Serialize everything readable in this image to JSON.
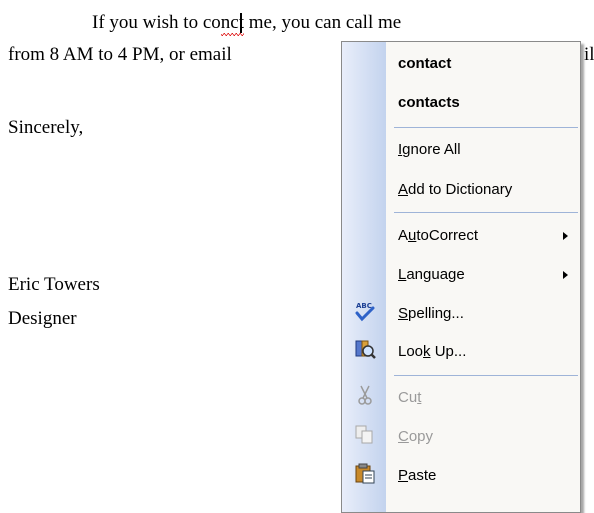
{
  "document": {
    "line1_before": "If you wish to co",
    "line1_misspelled_a": "n",
    "line1_misspelled_b": "ct",
    "line1_after": " me, you can call me",
    "line2": "from 8 AM to 4 PM, or email",
    "line2_tail": "il",
    "closing": "Sincerely,",
    "name": "Eric Towers",
    "title": "Designer"
  },
  "context_menu": {
    "suggestions": [
      "contact",
      "contacts"
    ],
    "items": [
      {
        "label": "Ignore All",
        "mnemonic": "I"
      },
      {
        "label": "Add to Dictionary",
        "mnemonic": "A"
      },
      {
        "label": "AutoCorrect",
        "mnemonic": "u",
        "submenu": true
      },
      {
        "label": "Language",
        "mnemonic": "L",
        "submenu": true
      },
      {
        "label": "Spelling...",
        "mnemonic": "S",
        "icon": "spelling-abc-check-icon"
      },
      {
        "label": "Look Up...",
        "mnemonic": "k",
        "icon": "research-book-magnifier-icon"
      },
      {
        "label": "Cut",
        "mnemonic": "t",
        "icon": "scissors-icon",
        "disabled": true
      },
      {
        "label": "Copy",
        "mnemonic": "C",
        "icon": "copy-icon",
        "disabled": true
      },
      {
        "label": "Paste",
        "mnemonic": "P",
        "icon": "paste-clipboard-icon"
      }
    ]
  },
  "colors": {
    "gutter_light": "#e9eefa",
    "gutter_dark": "#c3d3ee",
    "separator": "#9fb4d8",
    "squiggle": "#e02020"
  }
}
